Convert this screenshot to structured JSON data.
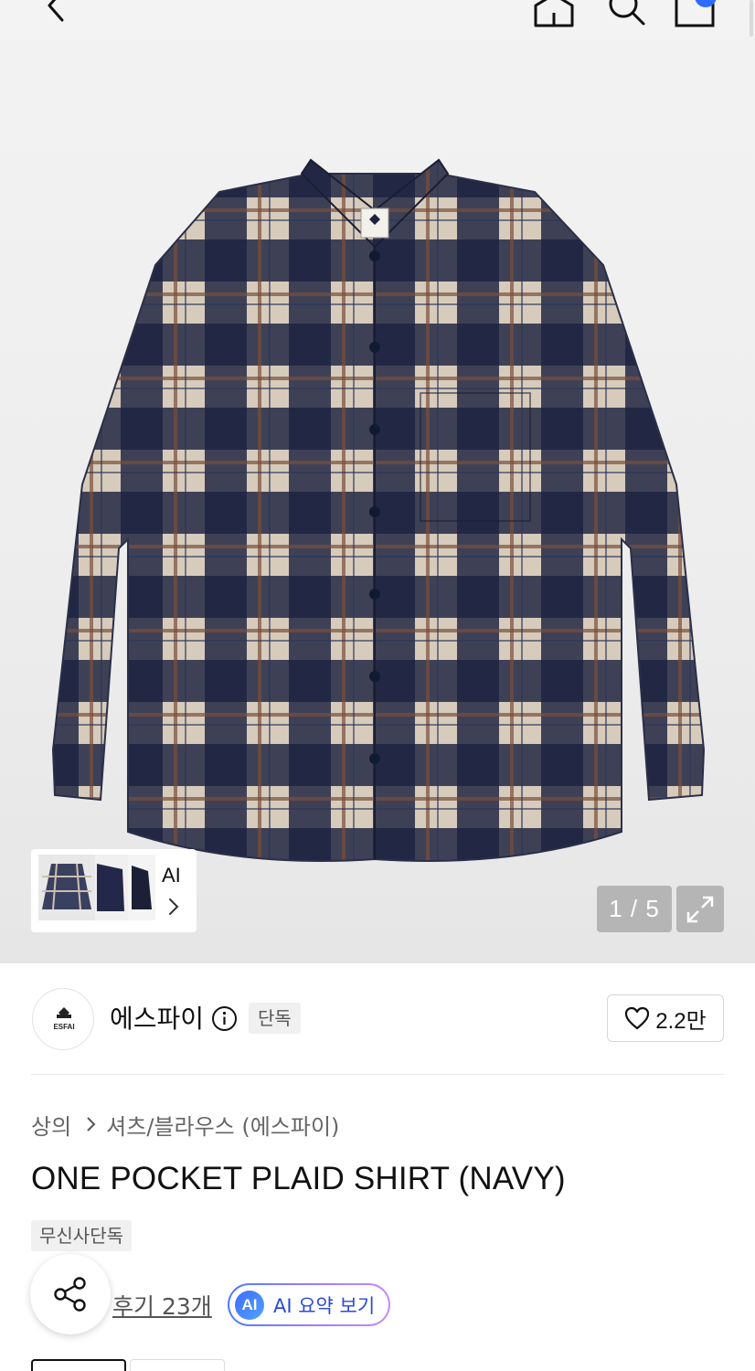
{
  "header": {
    "back_icon": "chevron-left-icon",
    "home_icon": "home-icon",
    "search_icon": "search-icon",
    "cart_icon": "shopping-bag-icon"
  },
  "gallery": {
    "ai_label": "AI",
    "page_current": "1",
    "page_total": "5",
    "page_indicator": "1 / 5",
    "expand_icon": "expand-icon"
  },
  "brand": {
    "logo_text": "ESFAI",
    "name": "에스파이",
    "badge": "단독",
    "like_count": "2.2만"
  },
  "breadcrumb": {
    "level1": "상의",
    "level2": "셔츠/블라우스 (에스파이)"
  },
  "product": {
    "title": "ONE POCKET PLAID SHIRT (NAVY)",
    "exclusive_badge": "무신사단독",
    "review_text": "후기 23개",
    "ai_summary_mark": "AI",
    "ai_summary_label": "AI 요약 보기"
  },
  "colors": {
    "accent_blue": "#2c49d8",
    "navy": "#1c2240",
    "beige": "#d9cdbd"
  }
}
